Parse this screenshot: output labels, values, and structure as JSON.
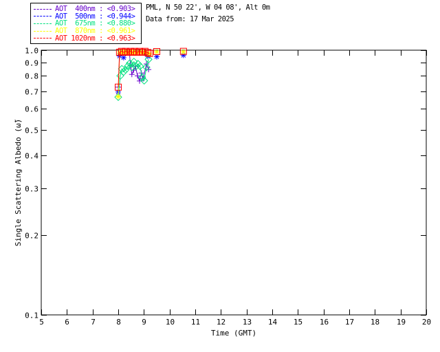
{
  "header": {
    "site_line": "PML, N 50 22', W 04 08', Alt 0m",
    "date_line": "Data from: 17 Mar 2025"
  },
  "chart_data": {
    "type": "line",
    "title": "",
    "xlabel": "Time (GMT)",
    "ylabel": "Single Scattering Albedo (ω̃)",
    "xlim": [
      5,
      20
    ],
    "ylim": [
      0.1,
      1.0
    ],
    "yscale": "log",
    "grid": false,
    "legend_position": "top-left-outside",
    "xticks": [
      "5",
      "6",
      "7",
      "8",
      "9",
      "10",
      "11",
      "12",
      "13",
      "14",
      "15",
      "16",
      "17",
      "18",
      "19",
      "20"
    ],
    "yticks": [
      "1.0",
      "0.9",
      "0.8",
      "0.7",
      "0.6",
      "0.5",
      "0.4",
      "0.3",
      "0.2",
      "0.1"
    ],
    "series": [
      {
        "name": "AOT 400nm",
        "wavelength": "400nm",
        "mean": "<0.903>",
        "legend_label": "AOT  400nm : <0.903>",
        "color": "#6600CC",
        "marker": "plus",
        "segments": [
          [
            [
              8.0,
              0.725
            ]
          ],
          [
            [
              8.43,
              0.985
            ],
            [
              8.48,
              0.875
            ],
            [
              8.53,
              0.81
            ],
            [
              8.6,
              0.84
            ],
            [
              8.67,
              0.87
            ],
            [
              8.75,
              0.8
            ],
            [
              8.83,
              0.765
            ],
            [
              8.9,
              0.82
            ],
            [
              8.97,
              0.78
            ],
            [
              9.1,
              0.887
            ],
            [
              9.18,
              0.845
            ]
          ]
        ]
      },
      {
        "name": "AOT 500nm",
        "wavelength": "500nm",
        "mean": "<0.944>",
        "legend_label": "AOT  500nm : <0.944>",
        "color": "#0000FF",
        "marker": "asterisk",
        "segments": [
          [
            [
              8.0,
              0.695
            ],
            [
              8.05,
              0.95
            ]
          ],
          [
            [
              8.21,
              0.937
            ]
          ],
          [
            [
              9.15,
              0.948
            ]
          ],
          [
            [
              9.5,
              0.945
            ]
          ],
          [
            [
              10.54,
              0.957
            ]
          ]
        ]
      },
      {
        "name": "AOT 675nm",
        "wavelength": "675nm",
        "mean": "<0.880>",
        "legend_label": "AOT  675nm : <0.880>",
        "color": "#00E07E",
        "marker": "diamond",
        "segments": [
          [
            [
              8.0,
              0.665
            ],
            [
              8.08,
              0.8
            ],
            [
              8.14,
              0.85
            ],
            [
              8.21,
              0.828
            ],
            [
              8.29,
              0.843
            ],
            [
              8.37,
              0.87
            ],
            [
              8.45,
              0.893
            ],
            [
              8.53,
              0.862
            ],
            [
              8.61,
              0.905
            ],
            [
              8.69,
              0.868
            ],
            [
              8.77,
              0.888
            ],
            [
              8.85,
              0.87
            ],
            [
              8.93,
              0.79
            ],
            [
              9.01,
              0.767
            ],
            [
              9.1,
              0.862
            ],
            [
              9.18,
              0.923
            ]
          ]
        ]
      },
      {
        "name": "AOT 870nm",
        "wavelength": "870nm",
        "mean": "<0.961>",
        "legend_label": "AOT  870nm : <0.961>",
        "color": "#FFFF00",
        "marker": "asterisk",
        "segments": [
          [
            [
              8.0,
              0.668
            ],
            [
              8.05,
              0.975
            ],
            [
              8.13,
              0.985
            ],
            [
              8.21,
              0.978
            ],
            [
              8.29,
              0.985
            ],
            [
              8.38,
              0.978
            ],
            [
              8.48,
              0.985
            ],
            [
              8.56,
              0.978
            ],
            [
              8.64,
              0.985
            ],
            [
              8.72,
              0.978
            ],
            [
              8.83,
              0.985
            ],
            [
              8.94,
              0.978
            ],
            [
              9.04,
              0.985
            ],
            [
              9.15,
              0.975
            ],
            [
              9.22,
              0.968
            ]
          ],
          [
            [
              9.5,
              0.985
            ]
          ],
          [
            [
              10.54,
              0.985
            ]
          ]
        ]
      },
      {
        "name": "AOT 1020nm",
        "wavelength": "1020nm",
        "mean": "<0.963>",
        "legend_label": "AOT 1020nm : <0.963>",
        "color": "#FF0000",
        "marker": "square",
        "segments": [
          [
            [
              8.0,
              0.725
            ],
            [
              8.05,
              0.982
            ],
            [
              8.13,
              0.99
            ],
            [
              8.21,
              0.982
            ],
            [
              8.29,
              0.99
            ],
            [
              8.38,
              0.982
            ],
            [
              8.48,
              0.99
            ],
            [
              8.56,
              0.982
            ],
            [
              8.64,
              0.99
            ],
            [
              8.72,
              0.982
            ],
            [
              8.83,
              0.99
            ],
            [
              8.94,
              0.982
            ],
            [
              9.04,
              0.99
            ],
            [
              9.15,
              0.98
            ],
            [
              9.22,
              0.972
            ]
          ],
          [
            [
              9.5,
              0.988
            ]
          ],
          [
            [
              10.54,
              0.99
            ]
          ]
        ]
      }
    ]
  }
}
